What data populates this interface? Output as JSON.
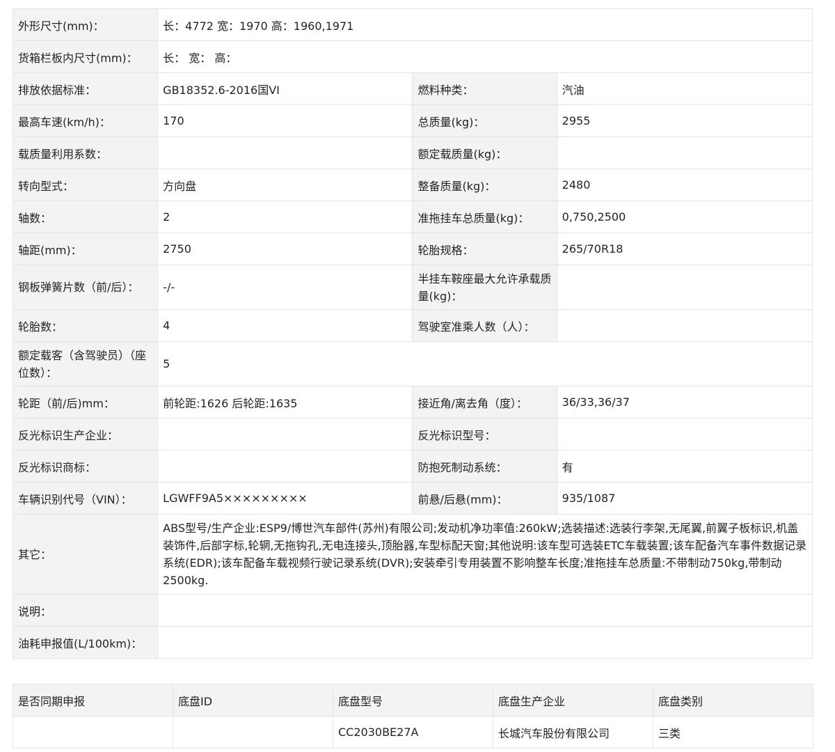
{
  "specs": {
    "dimensions": {
      "label": "外形尺寸(mm)：",
      "value": "长：4772 宽：1970 高：1960,1971"
    },
    "cargo_box": {
      "label": "货箱栏板内尺寸(mm)：",
      "value": "长： 宽： 高："
    },
    "emission": {
      "label": "排放依据标准：",
      "value": "GB18352.6-2016国VI"
    },
    "fuel": {
      "label": "燃料种类：",
      "value": "汽油"
    },
    "max_speed": {
      "label": "最高车速(km/h)：",
      "value": "170"
    },
    "total_mass": {
      "label": "总质量(kg)：",
      "value": "2955"
    },
    "load_factor": {
      "label": "载质量利用系数：",
      "value": ""
    },
    "rated_load": {
      "label": "额定载质量(kg)：",
      "value": ""
    },
    "steering": {
      "label": "转向型式：",
      "value": "方向盘"
    },
    "curb_mass": {
      "label": "整备质量(kg)：",
      "value": "2480"
    },
    "axles": {
      "label": "轴数：",
      "value": "2"
    },
    "towing_mass": {
      "label": "准拖挂车总质量(kg)：",
      "value": "0,750,2500"
    },
    "wheelbase": {
      "label": "轴距(mm)：",
      "value": "2750"
    },
    "tire_spec": {
      "label": "轮胎规格：",
      "value": "265/70R18"
    },
    "leaf_springs": {
      "label": "钢板弹簧片数（前/后）：",
      "value": "-/-"
    },
    "saddle_load": {
      "label": "半挂车鞍座最大允许承载质量(kg)：",
      "value": ""
    },
    "tire_count": {
      "label": "轮胎数：",
      "value": "4"
    },
    "cab_seats": {
      "label": "驾驶室准乘人数（人）：",
      "value": ""
    },
    "passengers": {
      "label": "额定载客（含驾驶员）（座位数）：",
      "value": "5"
    },
    "track": {
      "label": "轮距（前/后)mm：",
      "value": "前轮距:1626 后轮距:1635"
    },
    "angles": {
      "label": "接近角/离去角（度）：",
      "value": "36/33,36/37"
    },
    "reflector_maker": {
      "label": "反光标识生产企业：",
      "value": ""
    },
    "reflector_model": {
      "label": "反光标识型号：",
      "value": ""
    },
    "reflector_brand": {
      "label": "反光标识商标：",
      "value": ""
    },
    "abs": {
      "label": "防抱死制动系统：",
      "value": "有"
    },
    "vin": {
      "label": "车辆识别代号（VIN）：",
      "value": "LGWFF9A5×××××××××"
    },
    "overhang": {
      "label": "前悬/后悬(mm)：",
      "value": "935/1087"
    },
    "other": {
      "label": "其它：",
      "value": "ABS型号/生产企业:ESP9/博世汽车部件(苏州)有限公司;发动机净功率值:260kW;选装描述:选装行李架,无尾翼,前翼子板标识,机盖装饰件,后部字标,轮辋,无拖钩孔,无电连接头,顶胎器,车型标配天窗;其他说明:该车型可选装ETC车载装置;该车配备汽车事件数据记录系统(EDR);该车配备车载视频行驶记录系统(DVR);安装牵引专用装置不影响整车长度;准拖挂车总质量:不带制动750kg,带制动2500kg."
    },
    "note": {
      "label": "说明：",
      "value": ""
    },
    "fuel_consumption": {
      "label": "油耗申报值(L/100km)：",
      "value": ""
    }
  },
  "chassis": {
    "headers": [
      "是否同期申报",
      "底盘ID",
      "底盘型号",
      "底盘生产企业",
      "底盘类别"
    ],
    "row": [
      "",
      "",
      "CC2030BE27A",
      "长城汽车股份有限公司",
      "三类"
    ]
  }
}
